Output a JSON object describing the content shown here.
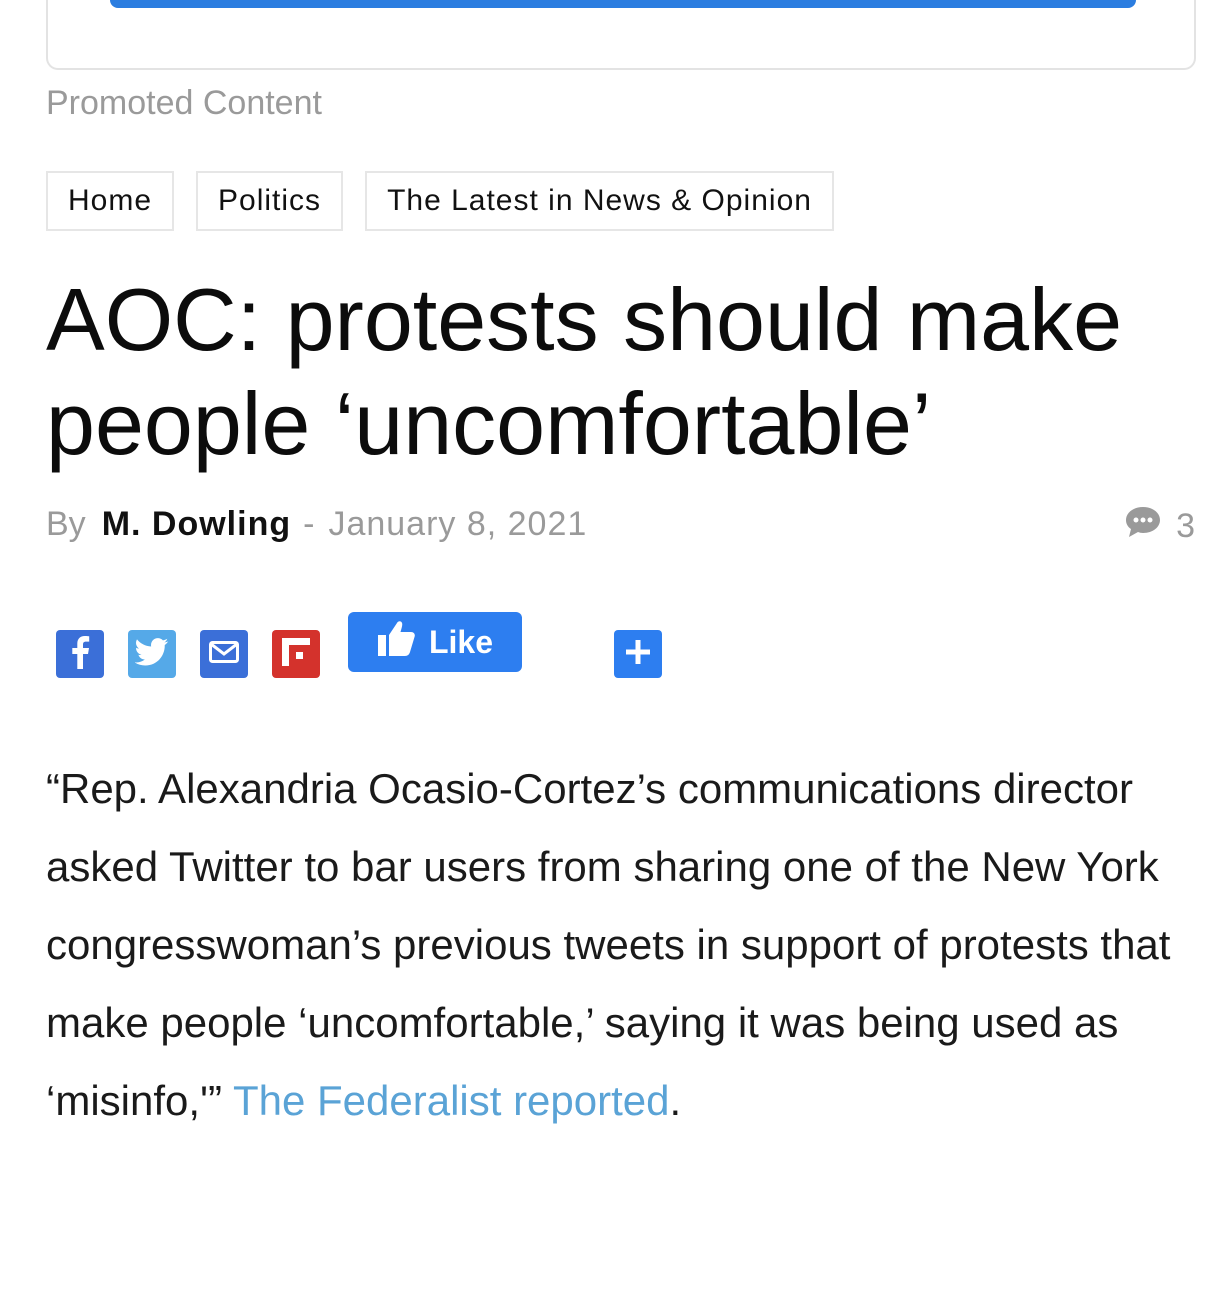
{
  "promo": {
    "label": "Promoted Content"
  },
  "breadcrumb": [
    {
      "label": "Home"
    },
    {
      "label": "Politics"
    },
    {
      "label": "The Latest in News & Opinion"
    }
  ],
  "article": {
    "title": "AOC: protests should make people ‘uncomfortable’",
    "by_label": "By",
    "author": "M. Dowling",
    "separator": "-",
    "date": "January 8, 2021",
    "comment_count": "3",
    "body_text": "“Rep. Alexandria Ocasio-Cortez’s communications director asked Twitter to bar users from sharing one of the New York congresswoman’s previous tweets in support of protests that make people ‘uncomfortable,’ saying it was being used as ‘misinfo,'” ",
    "link_text": "The Federalist reported",
    "trailing": "."
  },
  "share": {
    "like_label": "Like",
    "buttons": [
      {
        "icon": "facebook-icon",
        "color": "#3b6fd8"
      },
      {
        "icon": "twitter-icon",
        "color": "#55a9e8"
      },
      {
        "icon": "email-icon",
        "color": "#3b6fd8"
      },
      {
        "icon": "flipboard-icon",
        "color": "#d4322c"
      },
      {
        "icon": "plus-icon",
        "color": "#2d7ef0"
      }
    ]
  },
  "colors": {
    "accent_blue": "#2d7ef0",
    "link": "#5aa3d6",
    "muted": "#9a9a9a"
  }
}
